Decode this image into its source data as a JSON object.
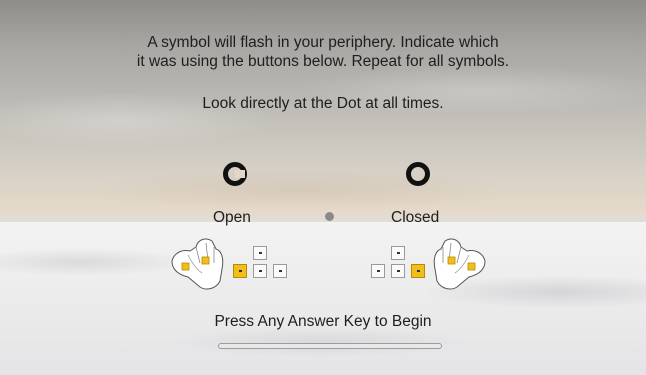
{
  "instructions": {
    "line1": "A symbol will flash in your periphery. Indicate which",
    "line2": "it was using the buttons below. Repeat for all symbols.",
    "line3": "Look directly at the Dot at all times."
  },
  "options": {
    "left_label": "Open",
    "right_label": "Closed"
  },
  "prompt": "Press Any Answer Key to Begin",
  "progress": 0,
  "icons": [
    "open-ring-symbol-icon",
    "closed-ring-symbol-icon",
    "fixation-dot",
    "left-hand-icon",
    "right-hand-icon"
  ],
  "colors": {
    "key_highlight": "#f2be1b",
    "symbol": "#111111",
    "text": "#1e1e1e"
  }
}
